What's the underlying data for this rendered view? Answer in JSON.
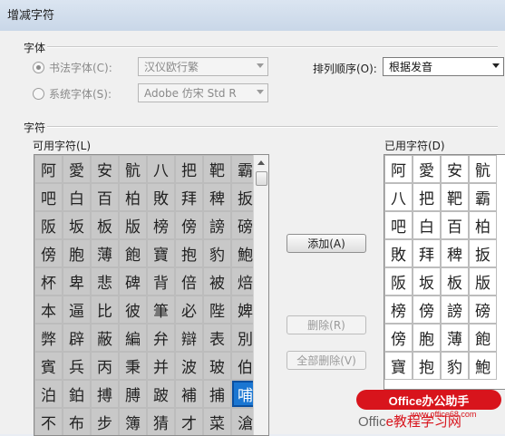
{
  "window": {
    "title": "增减字符"
  },
  "font_group": {
    "label": "字体",
    "calligraphy_radio": "书法字体(C):",
    "calligraphy_value": "汉仪欧行繁",
    "system_radio": "系统字体(S):",
    "system_value": "Adobe 仿宋 Std R",
    "sort_label": "排列顺序(O):",
    "sort_value": "根据发音"
  },
  "chars_group": {
    "label": "字符",
    "available_label": "可用字符(L)",
    "used_label": "已用字符(D)"
  },
  "available_chars": [
    "阿",
    "愛",
    "安",
    "骯",
    "八",
    "把",
    "靶",
    "霸",
    "吧",
    "白",
    "百",
    "柏",
    "敗",
    "拜",
    "稗",
    "扳",
    "阪",
    "坂",
    "板",
    "版",
    "榜",
    "傍",
    "謗",
    "磅",
    "傍",
    "胞",
    "薄",
    "飽",
    "寶",
    "抱",
    "豹",
    "鮑",
    "杯",
    "卑",
    "悲",
    "碑",
    "背",
    "倍",
    "被",
    "焙",
    "本",
    "逼",
    "比",
    "彼",
    "筆",
    "必",
    "陛",
    "婢",
    "弊",
    "辟",
    "蔽",
    "編",
    "弁",
    "辯",
    "表",
    "別",
    "賓",
    "兵",
    "丙",
    "秉",
    "并",
    "波",
    "玻",
    "伯",
    "泊",
    "鉑",
    "搏",
    "膊",
    "跛",
    "補",
    "捕",
    "哺",
    "不",
    "布",
    "步",
    "簿",
    "猜",
    "才",
    "菜",
    "滄"
  ],
  "used_chars": [
    "阿",
    "愛",
    "安",
    "骯",
    "八",
    "把",
    "靶",
    "霸",
    "吧",
    "白",
    "百",
    "柏",
    "敗",
    "拜",
    "稗",
    "扳",
    "阪",
    "坂",
    "板",
    "版",
    "榜",
    "傍",
    "謗",
    "磅",
    "傍",
    "胞",
    "薄",
    "飽",
    "寶",
    "抱",
    "豹",
    "鮑"
  ],
  "buttons": {
    "add": "添加(A)",
    "delete": "删除(R)",
    "delete_all": "全部删除(V)"
  },
  "watermark": {
    "badge": "Office办公助手",
    "site_prefix": "Offic",
    "site": "e教程学习网",
    "url": "www.office68.com"
  }
}
